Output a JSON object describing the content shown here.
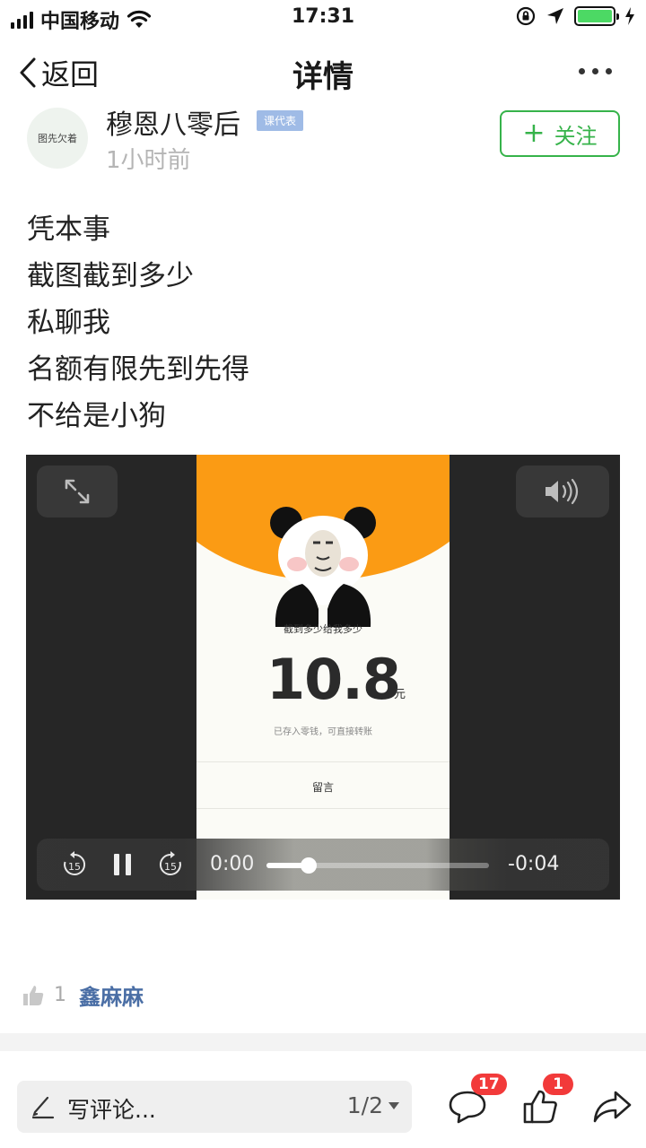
{
  "status_bar": {
    "carrier": "中国移动",
    "time": "17:31",
    "icons": [
      "signal-icon",
      "wifi-icon",
      "orientation-lock-icon",
      "location-icon",
      "battery-icon",
      "charging-icon"
    ]
  },
  "nav": {
    "back_label": "返回",
    "title": "详情"
  },
  "author": {
    "avatar_text": "图先欠着",
    "name": "穆恩八零后",
    "badge": "课代表",
    "time_ago": "1小时前",
    "follow_label": "关注"
  },
  "post": {
    "lines": [
      "凭本事",
      "截图截到多少",
      "私聊我",
      "名额有限先到先得",
      "不给是小狗"
    ]
  },
  "video": {
    "frame": {
      "caption": "截到多少给我多少",
      "amount": "10.8",
      "unit": "元",
      "note": "已存入零钱，可直接转账",
      "comment_label": "留言"
    },
    "player": {
      "current_time": "0:00",
      "remaining_time": "-0:04",
      "progress": 0.19,
      "skip_back_seconds": "15",
      "skip_forward_seconds": "15"
    }
  },
  "likes": {
    "count": "1",
    "user": "鑫麻麻"
  },
  "bottom_bar": {
    "comment_placeholder": "写评论...",
    "page_indicator": "1/2",
    "comment_count": "17",
    "like_count": "1"
  },
  "colors": {
    "accent_green": "#36b34a",
    "link_blue": "#4a6ea5",
    "badge_red": "#f23a3a",
    "video_orange": "#fb9b14"
  }
}
